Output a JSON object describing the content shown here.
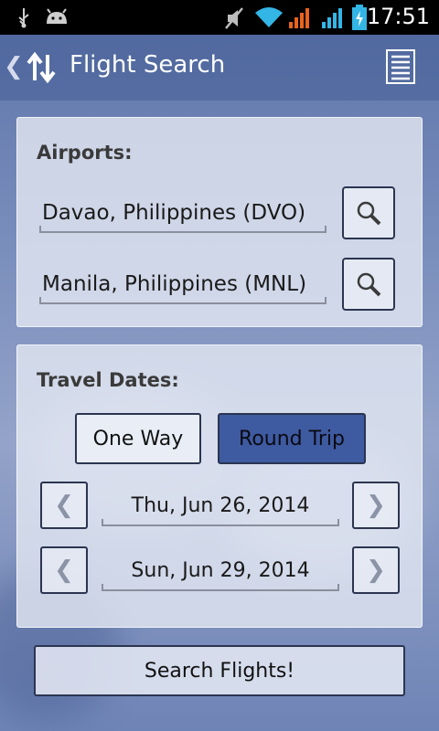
{
  "status_bar": {
    "time": "17:51"
  },
  "header": {
    "title": "Flight Search"
  },
  "airports": {
    "heading": "Airports:",
    "origin": "Davao, Philippines (DVO)",
    "destination": "Manila, Philippines (MNL)"
  },
  "travel_dates": {
    "heading": "Travel Dates:",
    "one_way_label": "One Way",
    "round_trip_label": "Round Trip",
    "selected_trip_type": "Round Trip",
    "departure_date": "Thu, Jun 26, 2014",
    "return_date": "Sun, Jun 29, 2014",
    "prev_glyph": "❮",
    "next_glyph": "❯"
  },
  "search_button_label": "Search Flights!",
  "colors": {
    "accent": "#3e5aa0",
    "status_bar_bg": "#000000",
    "signal_orange": "#e8641e",
    "wifi_blue": "#33b5e5"
  },
  "icons": [
    "usb-icon",
    "android-icon",
    "mute-icon",
    "wifi-icon",
    "signal-icon",
    "battery-icon",
    "search-icon",
    "menu-icon",
    "swap-arrows-icon"
  ]
}
